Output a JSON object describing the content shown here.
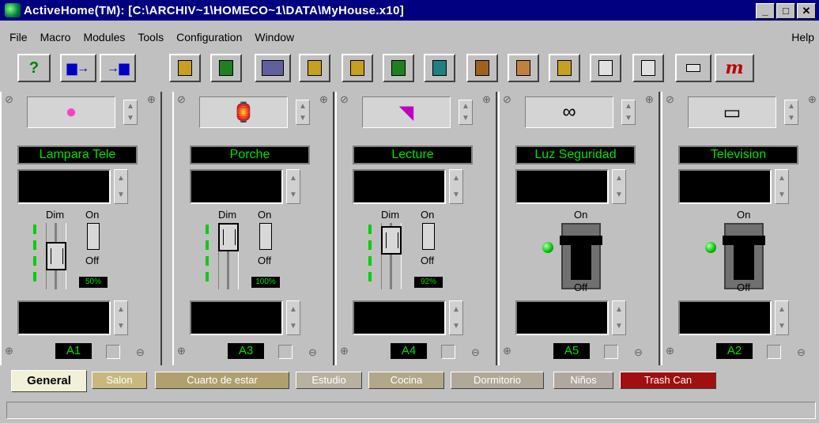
{
  "window": {
    "title": "ActiveHome(TM): [C:\\ARCHIV~1\\HOMECO~1\\DATA\\MyHouse.x10]",
    "minimize": "_",
    "restore": "□",
    "close": "✕"
  },
  "menu": {
    "items": [
      "File",
      "Macro",
      "Modules",
      "Tools",
      "Configuration",
      "Window"
    ],
    "help": "Help"
  },
  "toolbar": {
    "buttons": [
      "help-button",
      "save-to-interface-button",
      "load-from-interface-button",
      "module-1",
      "module-2",
      "module-3",
      "module-4",
      "module-5",
      "module-6",
      "module-7",
      "module-8",
      "module-9",
      "module-10",
      "module-11",
      "module-12",
      "macro-button"
    ],
    "help_glyph": "?",
    "macro_glyph": "m"
  },
  "modules": [
    {
      "name": "Lampara Tele",
      "icon": "lamp-icon",
      "type": "dimmer",
      "dim_label": "Dim",
      "on_label": "On",
      "off_label": "Off",
      "level": "50%",
      "address": "A1",
      "level_value": 0.5
    },
    {
      "name": "Porche",
      "icon": "porch-light-icon",
      "type": "dimmer",
      "dim_label": "Dim",
      "on_label": "On",
      "off_label": "Off",
      "level": "100%",
      "address": "A3",
      "level_value": 1.0
    },
    {
      "name": "Lecture",
      "icon": "reading-lamp-icon",
      "type": "dimmer",
      "dim_label": "Dim",
      "on_label": "On",
      "off_label": "Off",
      "level": "92%",
      "address": "A4",
      "level_value": 0.92
    },
    {
      "name": "Luz Seguridad",
      "icon": "binoculars-icon",
      "type": "appliance",
      "on_label": "On",
      "off_label": "Off",
      "address": "A5"
    },
    {
      "name": "Television",
      "icon": "tv-icon",
      "type": "appliance",
      "on_label": "On",
      "off_label": "Off",
      "address": "A2"
    }
  ],
  "tabs": [
    {
      "label": "General",
      "active": true,
      "color": "#f2f0d8"
    },
    {
      "label": "Salon",
      "color": "#c8b880"
    },
    {
      "label": "Cuarto de estar",
      "color": "#b0a070"
    },
    {
      "label": "Estudio",
      "color": "#b8b0a0"
    },
    {
      "label": "Cocina",
      "color": "#b0a888"
    },
    {
      "label": "Dormitorio",
      "color": "#b0a898"
    },
    {
      "label": "Niños",
      "color": "#b0a8a0"
    },
    {
      "label": "Trash Can",
      "color": "#a01010"
    }
  ],
  "status": {
    "text": ""
  }
}
